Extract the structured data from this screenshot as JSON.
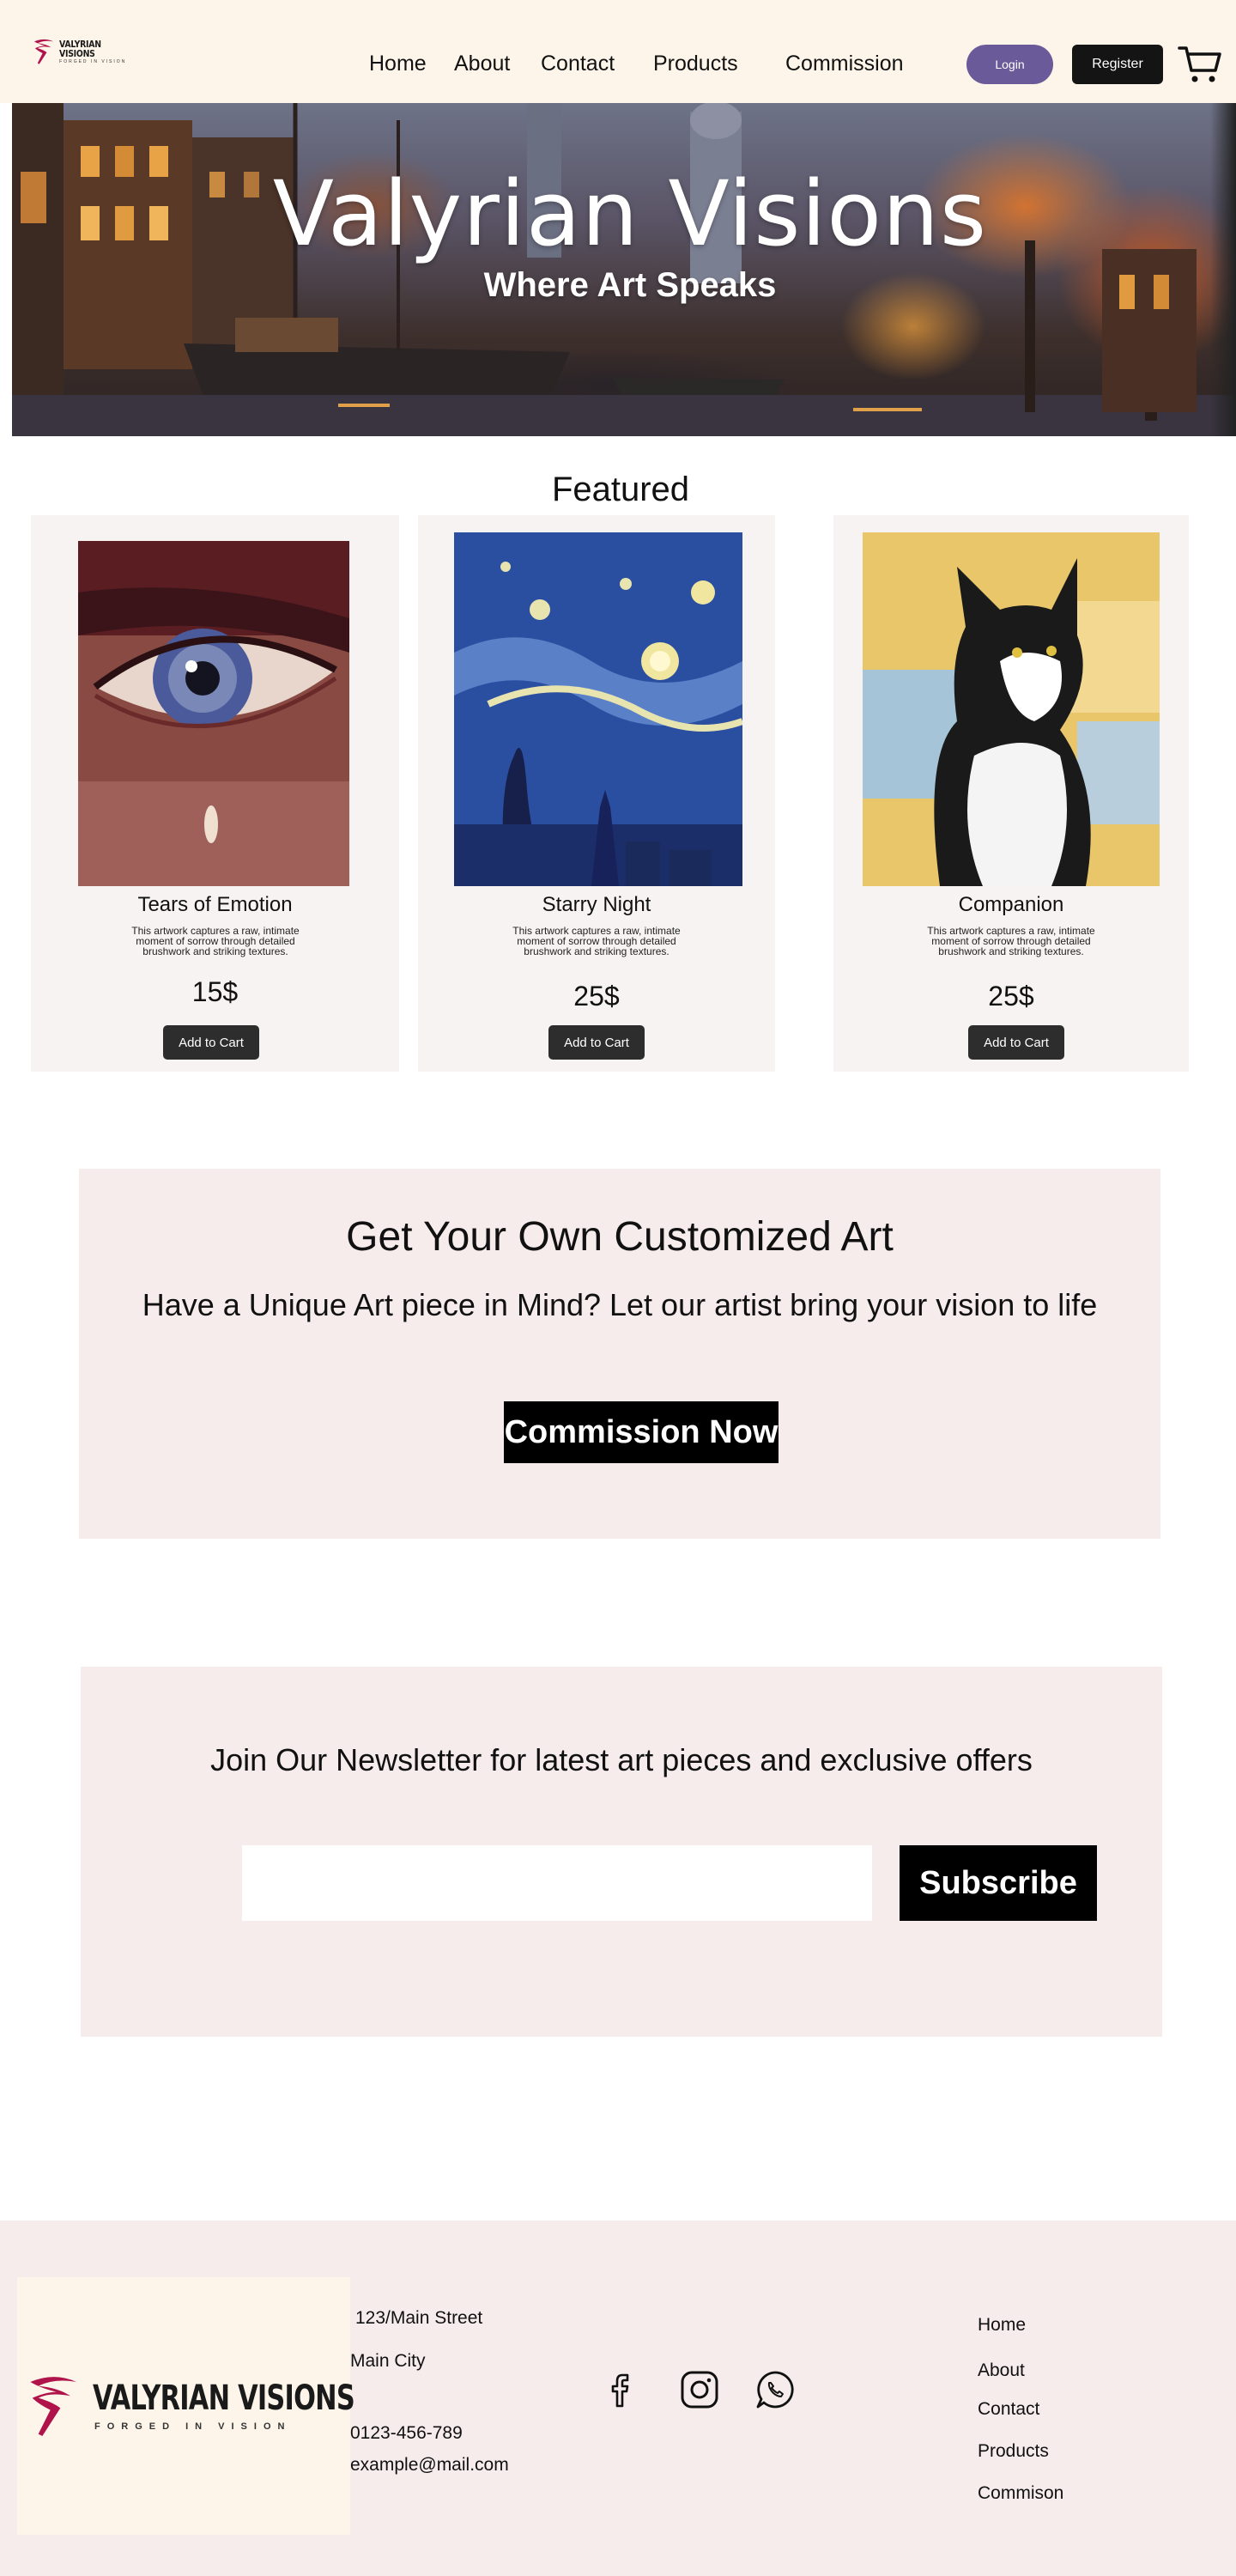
{
  "header": {
    "logo": {
      "brand": "VALYRIAN VISIONS",
      "tagline": "FORGED IN VISION"
    },
    "nav": [
      "Home",
      "About",
      "Contact",
      "Products",
      "Commission"
    ],
    "login_label": "Login",
    "register_label": "Register",
    "cart_icon": "cart-icon"
  },
  "hero": {
    "title": "Valyrian Visions",
    "subtitle": "Where Art Speaks"
  },
  "featured": {
    "title": "Featured",
    "products": [
      {
        "name": "Tears of Emotion",
        "description": "This artwork captures a raw, intimate moment of sorrow through detailed brushwork and striking textures.",
        "price": "15$",
        "button": "Add to Cart"
      },
      {
        "name": "Starry Night",
        "description": "This artwork captures a raw, intimate moment of sorrow through detailed brushwork and striking textures.",
        "price": "25$",
        "button": "Add to Cart"
      },
      {
        "name": "Companion",
        "description": "This artwork captures a raw, intimate moment of sorrow through detailed brushwork and striking textures.",
        "price": "25$",
        "button": "Add to Cart"
      }
    ]
  },
  "commission": {
    "title": "Get Your Own Customized Art",
    "subtitle": "Have a Unique Art piece in Mind? Let our artist bring your vision to life",
    "button": "Commission Now"
  },
  "newsletter": {
    "title": "Join Our Newsletter for latest art pieces and exclusive offers",
    "input_value": "",
    "button": "Subscribe"
  },
  "footer": {
    "logo": {
      "brand": "VALYRIAN VISIONS",
      "tagline": "FORGED IN VISION"
    },
    "address_line1": "123/Main Street",
    "address_line2": "Main City",
    "phone": "0123-456-789",
    "email": "example@mail.com",
    "social_icons": [
      "facebook-icon",
      "instagram-icon",
      "whatsapp-icon"
    ],
    "links": [
      "Home",
      "About",
      "Contact",
      "Products",
      "Commison"
    ]
  },
  "colors": {
    "header_bg": "#fdf5ea",
    "section_bg": "#f6ecec",
    "login_button": "#6a5a9a",
    "dark_button": "#141414",
    "brand_red": "#b0124a"
  }
}
